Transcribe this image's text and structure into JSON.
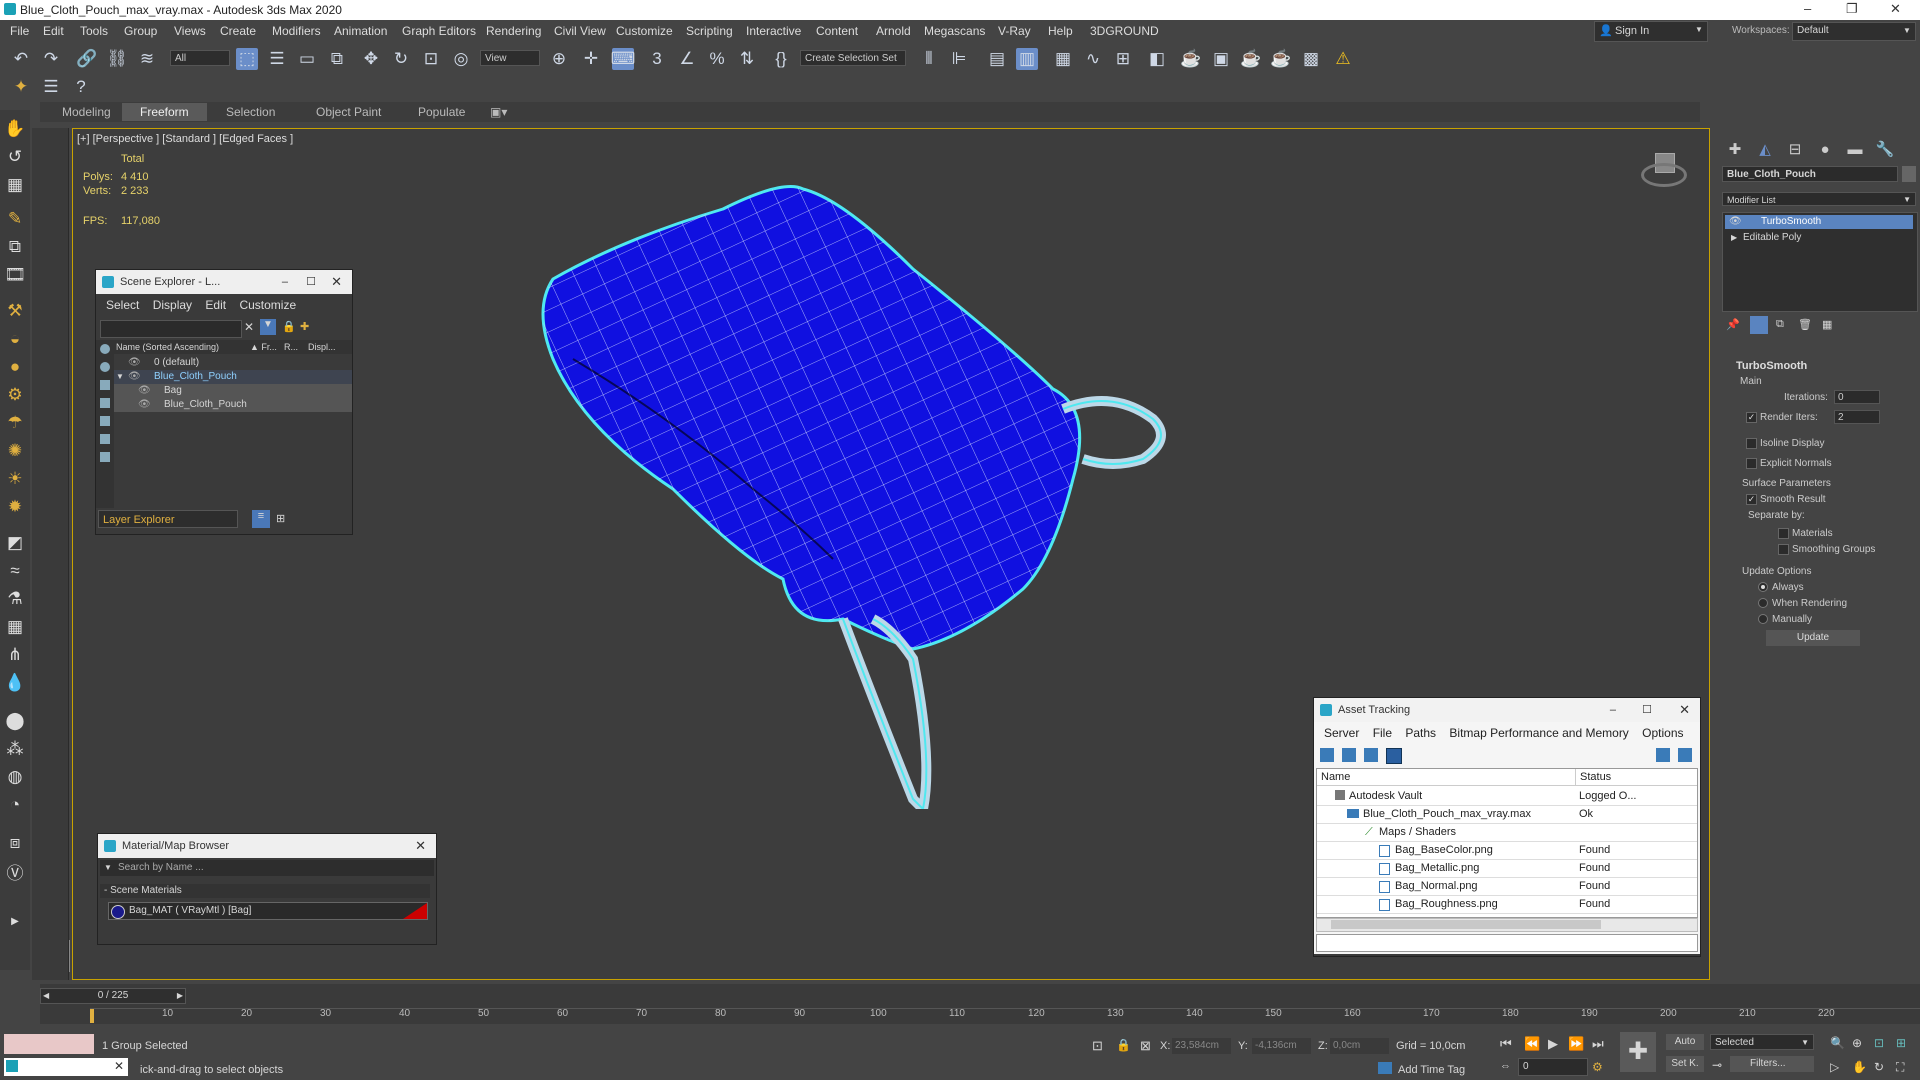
{
  "window": {
    "title": "Blue_Cloth_Pouch_max_vray.max - Autodesk 3ds Max 2020",
    "minimize": "–",
    "maximize": "❐",
    "close": "✕"
  },
  "menu": [
    "File",
    "Edit",
    "Tools",
    "Group",
    "Views",
    "Create",
    "Modifiers",
    "Animation",
    "Graph Editors",
    "Rendering",
    "Civil View",
    "Customize",
    "Scripting",
    "Interactive",
    "Content",
    "Arnold",
    "Megascans",
    "V-Ray",
    "Help",
    "3DGROUND"
  ],
  "account": {
    "sign_in": "Sign In",
    "workspaces_label": "Workspaces:",
    "workspace": "Default"
  },
  "toolbar": {
    "filter": "All",
    "view": "View",
    "selection_set": "Create Selection Set"
  },
  "ribbon": {
    "tabs": [
      "Modeling",
      "Freeform",
      "Selection",
      "Object Paint",
      "Populate"
    ],
    "selected": "Freeform"
  },
  "viewport": {
    "label": "[+] [Perspective ] [Standard ] [Edged Faces ]",
    "total": "Total",
    "polys_label": "Polys:",
    "polys": "4 410",
    "verts_label": "Verts:",
    "verts": "2 233",
    "fps_label": "FPS:",
    "fps": "117,080"
  },
  "scene_explorer": {
    "title": "Scene Explorer - L...",
    "menu": [
      "Select",
      "Display",
      "Edit",
      "Customize"
    ],
    "columns": [
      "Name (Sorted Ascending)",
      "▲ Fr...",
      "R...",
      "Displ..."
    ],
    "rows": [
      "0 (default)",
      "Blue_Cloth_Pouch",
      "Bag",
      "Blue_Cloth_Pouch"
    ],
    "footer": "Layer Explorer"
  },
  "material_browser": {
    "title": "Material/Map Browser",
    "search_placeholder": "Search by Name ...",
    "section": "- Scene Materials",
    "item": "Bag_MAT  ( VRayMtl )  [Bag]"
  },
  "asset_tracking": {
    "title": "Asset Tracking",
    "menu": [
      "Server",
      "File",
      "Paths",
      "Bitmap Performance and Memory",
      "Options"
    ],
    "col_name": "Name",
    "col_status": "Status",
    "rows": [
      {
        "name": "Autodesk Vault",
        "status": "Logged O..."
      },
      {
        "name": "Blue_Cloth_Pouch_max_vray.max",
        "status": "Ok"
      },
      {
        "name": "Maps / Shaders",
        "status": ""
      },
      {
        "name": "Bag_BaseColor.png",
        "status": "Found"
      },
      {
        "name": "Bag_Metallic.png",
        "status": "Found"
      },
      {
        "name": "Bag_Normal.png",
        "status": "Found"
      },
      {
        "name": "Bag_Roughness.png",
        "status": "Found"
      }
    ]
  },
  "command_panel": {
    "object_name": "Blue_Cloth_Pouch",
    "modifier_list": "Modifier List",
    "stack": [
      "TurboSmooth",
      "Editable Poly"
    ],
    "turbosmooth": {
      "title": "TurboSmooth",
      "main": "Main",
      "iterations_label": "Iterations:",
      "iterations": "0",
      "render_iters_label": "Render Iters:",
      "render_iters": "2",
      "isoline": "Isoline Display",
      "explicit": "Explicit Normals",
      "surface": "Surface Parameters",
      "smooth_result": "Smooth Result",
      "separate_by": "Separate by:",
      "materials": "Materials",
      "smoothing_groups": "Smoothing Groups",
      "update_options": "Update Options",
      "always": "Always",
      "when_rendering": "When Rendering",
      "manually": "Manually",
      "update_button": "Update"
    }
  },
  "timeline": {
    "frame": "0 / 225",
    "ticks": [
      "10",
      "20",
      "30",
      "40",
      "50",
      "60",
      "70",
      "80",
      "90",
      "100",
      "110",
      "120",
      "130",
      "140",
      "150",
      "160",
      "170",
      "180",
      "190",
      "200",
      "210",
      "220"
    ]
  },
  "status": {
    "selection": "1 Group Selected",
    "prompt": "ick-and-drag to select objects",
    "x_label": "X:",
    "x": "23,584cm",
    "y_label": "Y:",
    "y": "-4,136cm",
    "z_label": "Z:",
    "z": "0,0cm",
    "grid": "Grid = 10,0cm",
    "add_time_tag": "Add Time Tag",
    "auto": "Auto",
    "selected": "Selected",
    "set_key": "Set K.",
    "filters": "Filters...",
    "frame_field": "0"
  }
}
